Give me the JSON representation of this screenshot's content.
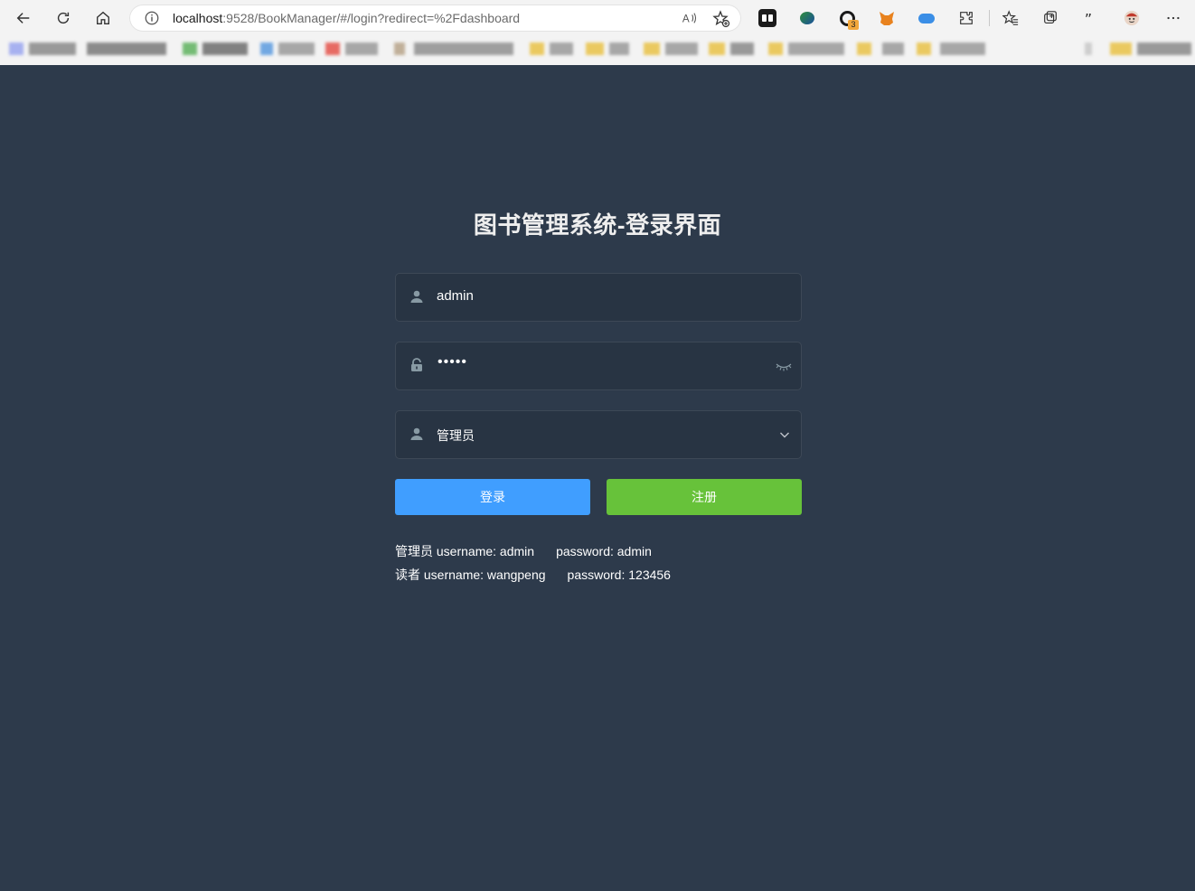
{
  "browser": {
    "url_host": "localhost",
    "url_rest": ":9528/BookManager/#/login?redirect=%2Fdashboard",
    "extension_badge": "3",
    "icons": [
      "back-icon",
      "refresh-icon",
      "home-icon",
      "info-icon",
      "read-aloud-icon",
      "add-favorite-icon",
      "favorites-icon",
      "collections-icon",
      "quote-icon",
      "more-icon",
      "extensions-icon"
    ]
  },
  "login": {
    "title": "图书管理系统-登录界面",
    "username_value": "admin",
    "password_masked": "•••••",
    "role_value": "管理员",
    "login_label": "登录",
    "register_label": "注册"
  },
  "tips": {
    "admin": {
      "role": "管理员",
      "username": "username: admin",
      "password": "password: admin"
    },
    "reader": {
      "role": "读者",
      "username": "username: wangpeng",
      "password": "password: 123456"
    }
  },
  "colors": {
    "background": "#2d3a4b",
    "input_bg": "#283443",
    "primary": "#409eff",
    "success": "#67c23a"
  }
}
